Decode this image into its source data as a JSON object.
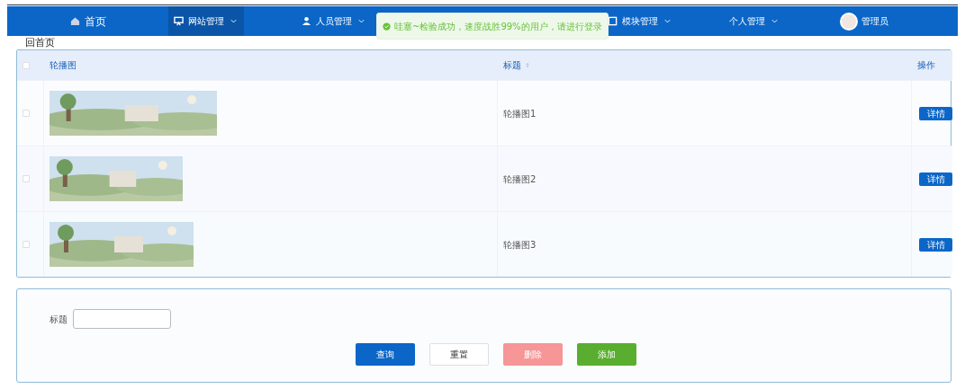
{
  "nav": {
    "items": [
      {
        "label": "首页",
        "selected": false,
        "has_menu": false
      },
      {
        "label": "网站管理",
        "selected": true,
        "has_menu": true
      },
      {
        "label": "人员管理",
        "selected": false,
        "has_menu": true
      },
      {
        "label": "模块管理",
        "selected": false,
        "has_menu": true
      },
      {
        "label": "个人管理",
        "selected": false,
        "has_menu": true
      }
    ],
    "user": {
      "name": "管理员"
    }
  },
  "toast": {
    "kind": "success",
    "message": "哇塞~检验成功，速度战胜99%的用户，请进行登录"
  },
  "back_link": "回首页",
  "table": {
    "select_all_checked": false,
    "columns": [
      {
        "label": "轮播图",
        "sortable": false
      },
      {
        "label": "标题",
        "sortable": true
      },
      {
        "label": "操作",
        "sortable": false
      }
    ],
    "rows": [
      {
        "checked": false,
        "title": "轮播图1",
        "action": "详情"
      },
      {
        "checked": false,
        "title": "轮播图2",
        "action": "详情"
      },
      {
        "checked": false,
        "title": "轮播图3",
        "action": "详情"
      }
    ]
  },
  "search": {
    "label": "标题"
  },
  "buttons": [
    {
      "label": "查询",
      "kind": "primary",
      "disabled": false
    },
    {
      "label": "重置",
      "kind": "default",
      "disabled": false
    },
    {
      "label": "删除",
      "kind": "danger",
      "disabled": true
    },
    {
      "label": "添加",
      "kind": "success",
      "disabled": false
    }
  ]
}
